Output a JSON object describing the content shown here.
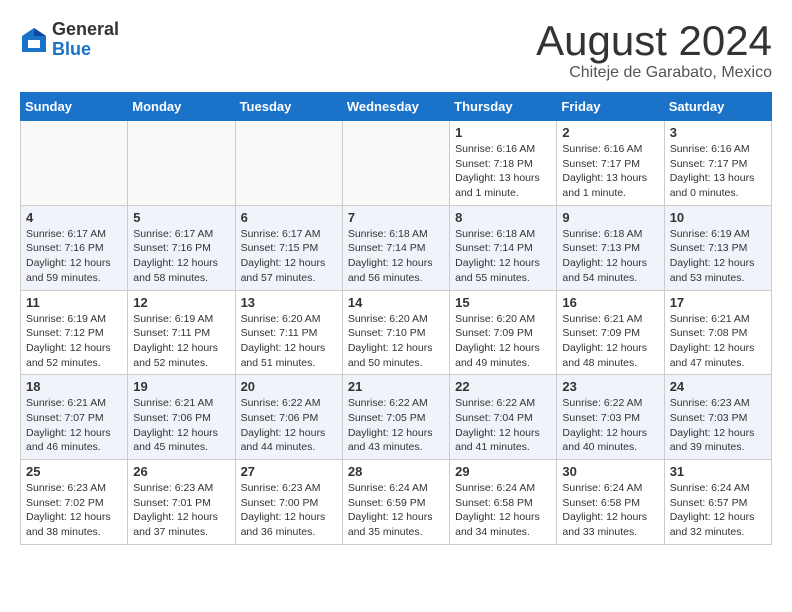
{
  "header": {
    "logo": {
      "line1": "General",
      "line2": "Blue"
    },
    "month_year": "August 2024",
    "location": "Chiteje de Garabato, Mexico"
  },
  "weekdays": [
    "Sunday",
    "Monday",
    "Tuesday",
    "Wednesday",
    "Thursday",
    "Friday",
    "Saturday"
  ],
  "weeks": [
    [
      {
        "day": "",
        "info": ""
      },
      {
        "day": "",
        "info": ""
      },
      {
        "day": "",
        "info": ""
      },
      {
        "day": "",
        "info": ""
      },
      {
        "day": "1",
        "info": "Sunrise: 6:16 AM\nSunset: 7:18 PM\nDaylight: 13 hours\nand 1 minute."
      },
      {
        "day": "2",
        "info": "Sunrise: 6:16 AM\nSunset: 7:17 PM\nDaylight: 13 hours\nand 1 minute."
      },
      {
        "day": "3",
        "info": "Sunrise: 6:16 AM\nSunset: 7:17 PM\nDaylight: 13 hours\nand 0 minutes."
      }
    ],
    [
      {
        "day": "4",
        "info": "Sunrise: 6:17 AM\nSunset: 7:16 PM\nDaylight: 12 hours\nand 59 minutes."
      },
      {
        "day": "5",
        "info": "Sunrise: 6:17 AM\nSunset: 7:16 PM\nDaylight: 12 hours\nand 58 minutes."
      },
      {
        "day": "6",
        "info": "Sunrise: 6:17 AM\nSunset: 7:15 PM\nDaylight: 12 hours\nand 57 minutes."
      },
      {
        "day": "7",
        "info": "Sunrise: 6:18 AM\nSunset: 7:14 PM\nDaylight: 12 hours\nand 56 minutes."
      },
      {
        "day": "8",
        "info": "Sunrise: 6:18 AM\nSunset: 7:14 PM\nDaylight: 12 hours\nand 55 minutes."
      },
      {
        "day": "9",
        "info": "Sunrise: 6:18 AM\nSunset: 7:13 PM\nDaylight: 12 hours\nand 54 minutes."
      },
      {
        "day": "10",
        "info": "Sunrise: 6:19 AM\nSunset: 7:13 PM\nDaylight: 12 hours\nand 53 minutes."
      }
    ],
    [
      {
        "day": "11",
        "info": "Sunrise: 6:19 AM\nSunset: 7:12 PM\nDaylight: 12 hours\nand 52 minutes."
      },
      {
        "day": "12",
        "info": "Sunrise: 6:19 AM\nSunset: 7:11 PM\nDaylight: 12 hours\nand 52 minutes."
      },
      {
        "day": "13",
        "info": "Sunrise: 6:20 AM\nSunset: 7:11 PM\nDaylight: 12 hours\nand 51 minutes."
      },
      {
        "day": "14",
        "info": "Sunrise: 6:20 AM\nSunset: 7:10 PM\nDaylight: 12 hours\nand 50 minutes."
      },
      {
        "day": "15",
        "info": "Sunrise: 6:20 AM\nSunset: 7:09 PM\nDaylight: 12 hours\nand 49 minutes."
      },
      {
        "day": "16",
        "info": "Sunrise: 6:21 AM\nSunset: 7:09 PM\nDaylight: 12 hours\nand 48 minutes."
      },
      {
        "day": "17",
        "info": "Sunrise: 6:21 AM\nSunset: 7:08 PM\nDaylight: 12 hours\nand 47 minutes."
      }
    ],
    [
      {
        "day": "18",
        "info": "Sunrise: 6:21 AM\nSunset: 7:07 PM\nDaylight: 12 hours\nand 46 minutes."
      },
      {
        "day": "19",
        "info": "Sunrise: 6:21 AM\nSunset: 7:06 PM\nDaylight: 12 hours\nand 45 minutes."
      },
      {
        "day": "20",
        "info": "Sunrise: 6:22 AM\nSunset: 7:06 PM\nDaylight: 12 hours\nand 44 minutes."
      },
      {
        "day": "21",
        "info": "Sunrise: 6:22 AM\nSunset: 7:05 PM\nDaylight: 12 hours\nand 43 minutes."
      },
      {
        "day": "22",
        "info": "Sunrise: 6:22 AM\nSunset: 7:04 PM\nDaylight: 12 hours\nand 41 minutes."
      },
      {
        "day": "23",
        "info": "Sunrise: 6:22 AM\nSunset: 7:03 PM\nDaylight: 12 hours\nand 40 minutes."
      },
      {
        "day": "24",
        "info": "Sunrise: 6:23 AM\nSunset: 7:03 PM\nDaylight: 12 hours\nand 39 minutes."
      }
    ],
    [
      {
        "day": "25",
        "info": "Sunrise: 6:23 AM\nSunset: 7:02 PM\nDaylight: 12 hours\nand 38 minutes."
      },
      {
        "day": "26",
        "info": "Sunrise: 6:23 AM\nSunset: 7:01 PM\nDaylight: 12 hours\nand 37 minutes."
      },
      {
        "day": "27",
        "info": "Sunrise: 6:23 AM\nSunset: 7:00 PM\nDaylight: 12 hours\nand 36 minutes."
      },
      {
        "day": "28",
        "info": "Sunrise: 6:24 AM\nSunset: 6:59 PM\nDaylight: 12 hours\nand 35 minutes."
      },
      {
        "day": "29",
        "info": "Sunrise: 6:24 AM\nSunset: 6:58 PM\nDaylight: 12 hours\nand 34 minutes."
      },
      {
        "day": "30",
        "info": "Sunrise: 6:24 AM\nSunset: 6:58 PM\nDaylight: 12 hours\nand 33 minutes."
      },
      {
        "day": "31",
        "info": "Sunrise: 6:24 AM\nSunset: 6:57 PM\nDaylight: 12 hours\nand 32 minutes."
      }
    ]
  ]
}
